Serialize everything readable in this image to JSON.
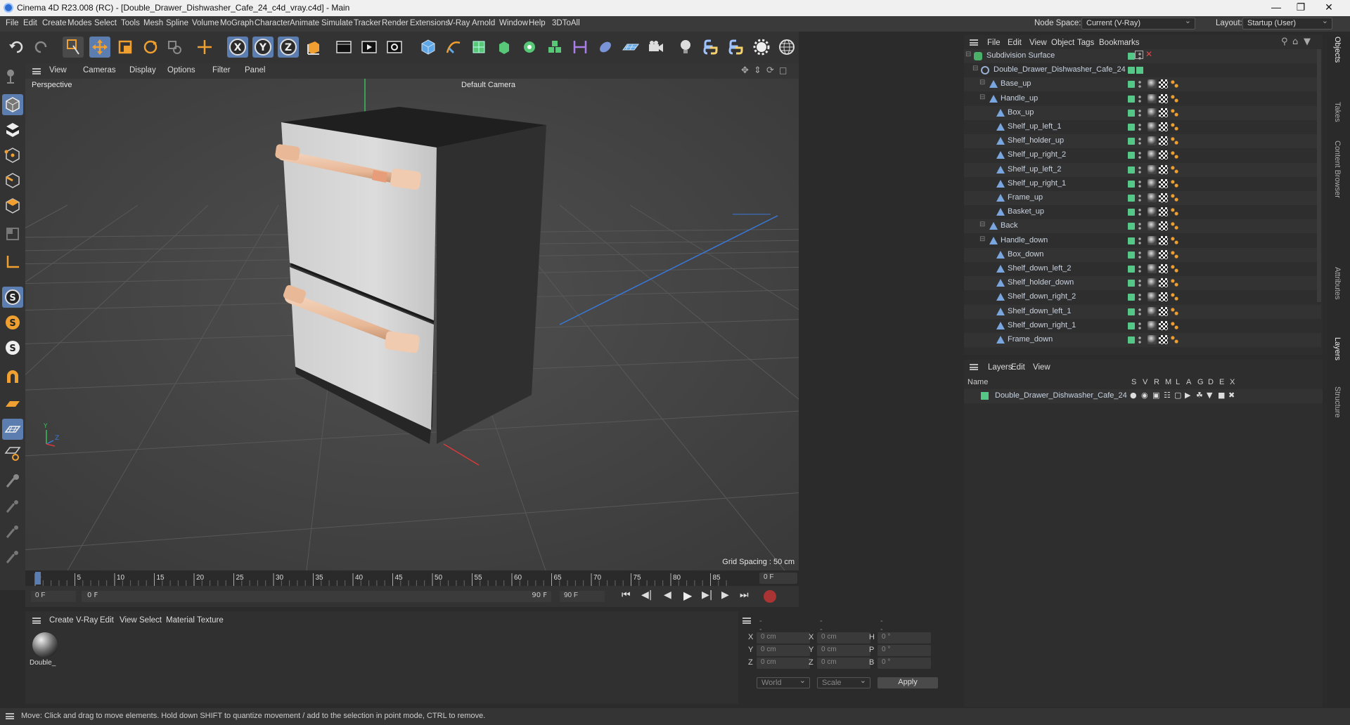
{
  "window": {
    "title": "Cinema 4D R23.008 (RC) - [Double_Drawer_Dishwasher_Cafe_24_c4d_vray.c4d] - Main"
  },
  "menu": {
    "items": [
      "File",
      "Edit",
      "Create",
      "Modes",
      "Select",
      "Tools",
      "Mesh",
      "Spline",
      "Volume",
      "MoGraph",
      "Character",
      "Animate",
      "Simulate",
      "Tracker",
      "Render",
      "Extensions",
      "V-Ray",
      "Arnold",
      "Window",
      "Help",
      "3DToAll"
    ],
    "node_space_label": "Node Space:",
    "node_space_value": "Current (V-Ray)",
    "layout_label": "Layout:",
    "layout_value": "Startup (User)"
  },
  "viewport": {
    "menu": [
      "View",
      "Cameras",
      "Display",
      "Options",
      "Filter",
      "Panel"
    ],
    "label": "Perspective",
    "camera": "Default Camera",
    "grid_spacing": "Grid Spacing : 50 cm"
  },
  "timeline": {
    "ticks": [
      "0",
      "5",
      "10",
      "15",
      "20",
      "25",
      "30",
      "35",
      "40",
      "45",
      "50",
      "55",
      "60",
      "65",
      "70",
      "75",
      "80",
      "85",
      "90"
    ],
    "current_frame": "0 F",
    "start_frame": "0 F",
    "range_start": "0 F",
    "range_end": "90 F",
    "end_frame": "90 F",
    "end_field": "90 F"
  },
  "materials": {
    "menu": [
      "Create",
      "V-Ray",
      "Edit",
      "View",
      "Select",
      "Material",
      "Texture"
    ],
    "items": [
      {
        "name": "Double_"
      }
    ]
  },
  "coords": {
    "header": [
      "--",
      "--",
      "--"
    ],
    "rows": [
      {
        "a": "X",
        "av": "0 cm",
        "b": "X",
        "bv": "0 cm",
        "c": "H",
        "cv": "0 °"
      },
      {
        "a": "Y",
        "av": "0 cm",
        "b": "Y",
        "bv": "0 cm",
        "c": "P",
        "cv": "0 °"
      },
      {
        "a": "Z",
        "av": "0 cm",
        "b": "Z",
        "bv": "0 cm",
        "c": "B",
        "cv": "0 °"
      }
    ],
    "space": "World",
    "mode": "Scale",
    "apply": "Apply"
  },
  "objects": {
    "menu": [
      "File",
      "Edit",
      "View",
      "Object",
      "Tags",
      "Bookmarks"
    ],
    "tree": [
      {
        "name": "Subdivision Surface",
        "depth": 0,
        "kind": "subdiv"
      },
      {
        "name": "Double_Drawer_Dishwasher_Cafe_24",
        "depth": 1,
        "kind": "null"
      },
      {
        "name": "Base_up",
        "depth": 2,
        "kind": "poly"
      },
      {
        "name": "Handle_up",
        "depth": 2,
        "kind": "poly"
      },
      {
        "name": "Box_up",
        "depth": 3,
        "kind": "poly"
      },
      {
        "name": "Shelf_up_left_1",
        "depth": 3,
        "kind": "poly"
      },
      {
        "name": "Shelf_holder_up",
        "depth": 3,
        "kind": "poly"
      },
      {
        "name": "Shelf_up_right_2",
        "depth": 3,
        "kind": "poly"
      },
      {
        "name": "Shelf_up_left_2",
        "depth": 3,
        "kind": "poly"
      },
      {
        "name": "Shelf_up_right_1",
        "depth": 3,
        "kind": "poly"
      },
      {
        "name": "Frame_up",
        "depth": 3,
        "kind": "poly"
      },
      {
        "name": "Basket_up",
        "depth": 3,
        "kind": "poly"
      },
      {
        "name": "Back",
        "depth": 2,
        "kind": "poly"
      },
      {
        "name": "Handle_down",
        "depth": 2,
        "kind": "poly"
      },
      {
        "name": "Box_down",
        "depth": 3,
        "kind": "poly"
      },
      {
        "name": "Shelf_down_left_2",
        "depth": 3,
        "kind": "poly"
      },
      {
        "name": "Shelf_holder_down",
        "depth": 3,
        "kind": "poly"
      },
      {
        "name": "Shelf_down_right_2",
        "depth": 3,
        "kind": "poly"
      },
      {
        "name": "Shelf_down_left_1",
        "depth": 3,
        "kind": "poly"
      },
      {
        "name": "Shelf_down_right_1",
        "depth": 3,
        "kind": "poly"
      },
      {
        "name": "Frame_down",
        "depth": 3,
        "kind": "poly"
      }
    ]
  },
  "layers": {
    "menu": [
      "Layers",
      "Edit",
      "View"
    ],
    "columns": [
      "Name",
      "S",
      "V",
      "R",
      "M",
      "L",
      "A",
      "G",
      "D",
      "E",
      "X"
    ],
    "items": [
      {
        "name": "Double_Drawer_Dishwasher_Cafe_24",
        "color": "#55c888"
      }
    ]
  },
  "right_tabs": [
    "Objects",
    "Takes",
    "Content Browser",
    "Attributes",
    "Layers",
    "Structure"
  ],
  "status": "Move: Click and drag to move elements. Hold down SHIFT to quantize movement / add to the selection in point mode, CTRL to remove.",
  "colors": {
    "accent": "#5b7db0",
    "orange": "#f0a030",
    "green": "#55c888"
  }
}
